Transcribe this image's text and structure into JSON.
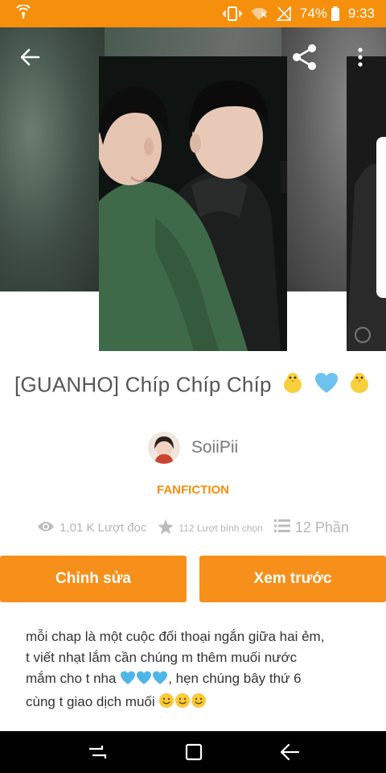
{
  "status_bar": {
    "battery": "74%",
    "time": "9:33",
    "icons": [
      "wifi-calling-icon",
      "vibrate-icon",
      "wifi-icon",
      "no-signal-icon",
      "battery-icon"
    ]
  },
  "toolbar": {
    "icons": [
      "back-arrow-icon",
      "share-icon",
      "more-vert-icon"
    ]
  },
  "story": {
    "title": "[GUANHO] Chíp Chíp Chíp",
    "title_emojis": [
      "chick-emoji",
      "blue-heart-emoji",
      "chick-emoji"
    ],
    "author": "SoiiPii",
    "category": "FANFICTION",
    "reads": "1,01 K Lượt đọc",
    "votes": "112 Lượt bình chọn",
    "parts": "12 Phần"
  },
  "actions": {
    "edit_label": "Chỉnh sửa",
    "preview_label": "Xem trước"
  },
  "description": {
    "line1": "mỗi chap là một cuộc đối thoại ngắn giữa hai ẻm,",
    "line2": "t viết nhạt lắm cần chúng m thêm muối nước",
    "line3_a": "mắm cho t nha",
    "line3_b": ", hẹn chúng bây thứ 6",
    "line4": "cùng t giao dịch muối"
  },
  "colors": {
    "accent": "#f58f0c",
    "button": "#f7901a",
    "heart": "#4fb6e8"
  },
  "nav": {
    "icons": [
      "recent-apps-icon",
      "home-icon",
      "back-icon"
    ]
  }
}
